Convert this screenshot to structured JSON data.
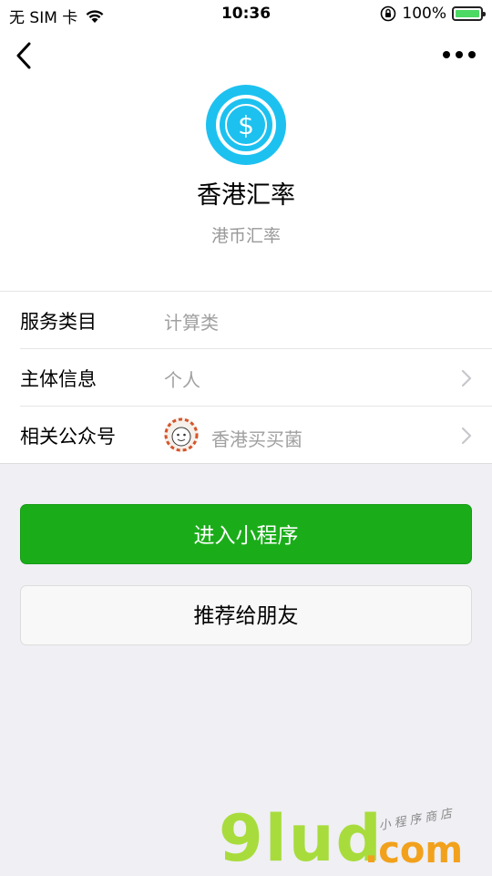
{
  "status_bar": {
    "carrier": "无 SIM 卡",
    "time": "10:36",
    "battery_percent": "100%",
    "battery_level": 1.0,
    "icons": [
      "wifi-icon",
      "orientation-lock-icon",
      "battery-icon"
    ]
  },
  "nav": {
    "back_icon": "chevron-left-icon",
    "more_icon": "more-dots-icon"
  },
  "app": {
    "name": "香港汇率",
    "description": "港币汇率",
    "logo_icon": "dollar-coin-icon",
    "logo_color": "#1cc1f0"
  },
  "info": [
    {
      "label": "服务类目",
      "value": "计算类",
      "has_chevron": false
    },
    {
      "label": "主体信息",
      "value": "个人",
      "has_chevron": true
    },
    {
      "label": "相关公众号",
      "value": "香港买买菌",
      "has_chevron": true,
      "avatar_icon": "account-avatar-icon"
    }
  ],
  "buttons": {
    "enter": "进入小程序",
    "recommend": "推荐给朋友"
  },
  "colors": {
    "primary_green": "#1aad19",
    "background": "#efeff4"
  },
  "watermark": {
    "brand": "9lud",
    "domain": ".com",
    "tagline": "小程序商店"
  }
}
